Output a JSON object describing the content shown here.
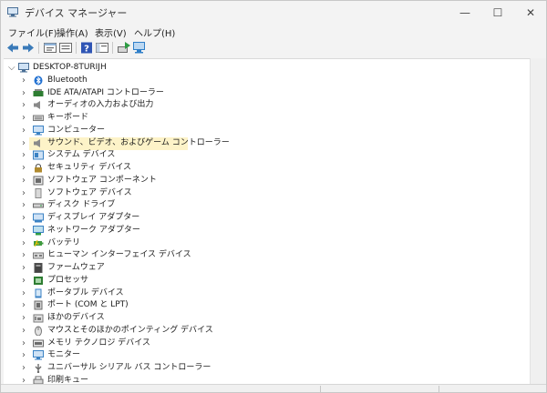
{
  "window": {
    "title": "デバイス マネージャー",
    "minimize_glyph": "—",
    "maximize_glyph": "☐",
    "close_glyph": "✕"
  },
  "menu": [
    {
      "label": "ファイル(F)"
    },
    {
      "label": "操作(A)"
    },
    {
      "label": "表示(V)"
    },
    {
      "label": "ヘルプ(H)"
    }
  ],
  "toolbar": [
    {
      "icon": "back-arrow-icon",
      "color": "#3a7ab8"
    },
    {
      "icon": "forward-arrow-icon",
      "color": "#3a7ab8"
    },
    {
      "icon": "properties-icon",
      "color": "#6b6b6b"
    },
    {
      "icon": "list-view-icon",
      "color": "#6b6b6b"
    },
    {
      "icon": "help-icon",
      "color": "#2f55b5"
    },
    {
      "icon": "console-icon",
      "color": "#6b6b6b"
    },
    {
      "icon": "update-driver-icon",
      "color": "#2e9c44"
    },
    {
      "icon": "scan-hardware-icon",
      "color": "#2f7fc8"
    }
  ],
  "tree": {
    "root": {
      "label": "DESKTOP-8TURIJH",
      "icon": "computer-icon",
      "expanded": true
    },
    "selected_index": 5,
    "items": [
      {
        "label": "Bluetooth",
        "icon": "bluetooth-icon",
        "color": "#1f6fd1"
      },
      {
        "label": "IDE ATA/ATAPI コントローラー",
        "icon": "ide-controller-icon",
        "color": "#2e7d32"
      },
      {
        "label": "オーディオの入力および出力",
        "icon": "speaker-icon",
        "color": "#8a8a8a"
      },
      {
        "label": "キーボード",
        "icon": "keyboard-icon",
        "color": "#7a7a7a"
      },
      {
        "label": "コンピューター",
        "icon": "monitor-icon",
        "color": "#3b82c4"
      },
      {
        "label": "サウンド、ビデオ、およびゲーム コントローラー",
        "icon": "speaker-icon",
        "color": "#8a8a8a"
      },
      {
        "label": "システム デバイス",
        "icon": "system-device-icon",
        "color": "#3b82c4"
      },
      {
        "label": "セキュリティ デバイス",
        "icon": "security-device-icon",
        "color": "#b08a2e"
      },
      {
        "label": "ソフトウェア コンポーネント",
        "icon": "software-component-icon",
        "color": "#6b6b6b"
      },
      {
        "label": "ソフトウェア デバイス",
        "icon": "software-device-icon",
        "color": "#8a8a8a"
      },
      {
        "label": "ディスク ドライブ",
        "icon": "disk-drive-icon",
        "color": "#6b6b6b"
      },
      {
        "label": "ディスプレイ アダプター",
        "icon": "display-adapter-icon",
        "color": "#3b82c4"
      },
      {
        "label": "ネットワーク アダプター",
        "icon": "network-adapter-icon",
        "color": "#3b82c4"
      },
      {
        "label": "バッテリ",
        "icon": "battery-icon",
        "color": "#3f9b3f"
      },
      {
        "label": "ヒューマン インターフェイス デバイス",
        "icon": "hid-icon",
        "color": "#7a7a7a"
      },
      {
        "label": "ファームウェア",
        "icon": "firmware-icon",
        "color": "#555555"
      },
      {
        "label": "プロセッサ",
        "icon": "processor-icon",
        "color": "#2e7d32"
      },
      {
        "label": "ポータブル デバイス",
        "icon": "portable-device-icon",
        "color": "#3b82c4"
      },
      {
        "label": "ポート (COM と LPT)",
        "icon": "port-icon",
        "color": "#6b6b6b"
      },
      {
        "label": "ほかのデバイス",
        "icon": "other-device-icon",
        "color": "#7a7a7a"
      },
      {
        "label": "マウスとそのほかのポインティング デバイス",
        "icon": "mouse-icon",
        "color": "#7a7a7a"
      },
      {
        "label": "メモリ テクノロジ デバイス",
        "icon": "memory-device-icon",
        "color": "#6b6b6b"
      },
      {
        "label": "モニター",
        "icon": "monitor-icon",
        "color": "#3b82c4"
      },
      {
        "label": "ユニバーサル シリアル バス コントローラー",
        "icon": "usb-icon",
        "color": "#6b6b6b"
      },
      {
        "label": "印刷キュー",
        "icon": "printer-icon",
        "color": "#6b6b6b"
      }
    ]
  },
  "colors": {
    "selection": "#fdf3c8",
    "window_bg": "#f3f3f3",
    "tree_bg": "#ffffff"
  }
}
